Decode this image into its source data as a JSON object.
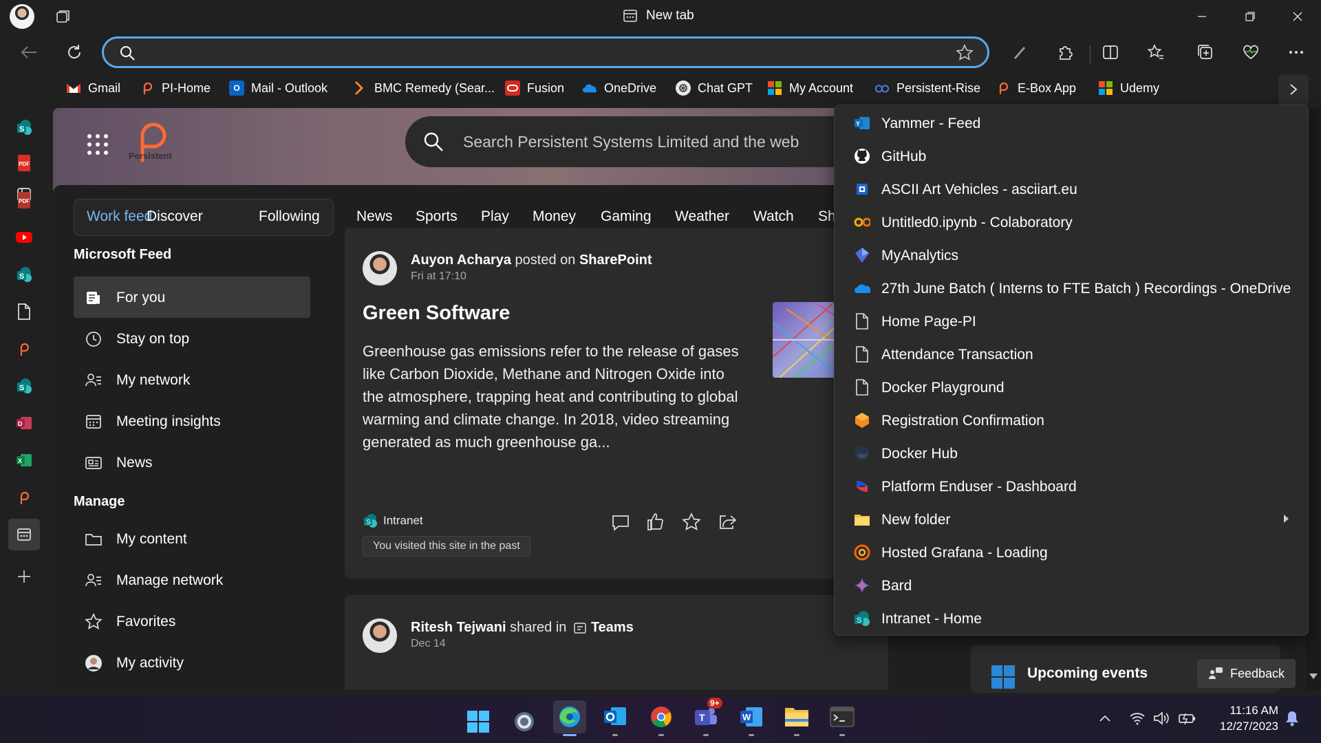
{
  "window": {
    "title": "New tab"
  },
  "toolbar": {
    "address_value": "",
    "address_placeholder": ""
  },
  "favorites": [
    {
      "label": "Gmail",
      "icon": "gmail-icon"
    },
    {
      "label": "PI-Home",
      "icon": "persistent-icon"
    },
    {
      "label": "Mail - Outlook",
      "icon": "outlook-icon"
    },
    {
      "label": "BMC Remedy (Sear...",
      "icon": "bmc-icon"
    },
    {
      "label": "Fusion",
      "icon": "oracle-icon"
    },
    {
      "label": "OneDrive",
      "icon": "onedrive-icon"
    },
    {
      "label": "Chat GPT",
      "icon": "chatgpt-icon"
    },
    {
      "label": "My Account",
      "icon": "microsoft-icon"
    },
    {
      "label": "Persistent-Rise",
      "icon": "rise-icon"
    },
    {
      "label": "E-Box App",
      "icon": "persistent-icon"
    },
    {
      "label": "Udemy",
      "icon": "microsoft-icon"
    }
  ],
  "hero": {
    "search_placeholder": "Search Persistent Systems Limited and the web",
    "logo_text": "Persistent"
  },
  "tabs": {
    "pill": [
      "Work feed",
      "Discover",
      "Following"
    ],
    "categories": [
      "News",
      "Sports",
      "Play",
      "Money",
      "Gaming",
      "Weather",
      "Watch",
      "Sh"
    ]
  },
  "feed_nav": {
    "heading": "Microsoft Feed",
    "items": [
      {
        "label": "For you",
        "icon": "news-feed-icon"
      },
      {
        "label": "Stay on top",
        "icon": "clock-icon"
      },
      {
        "label": "My network",
        "icon": "people-icon"
      },
      {
        "label": "Meeting insights",
        "icon": "calendar-icon"
      },
      {
        "label": "News",
        "icon": "newspaper-icon"
      }
    ],
    "manage_heading": "Manage",
    "manage_items": [
      {
        "label": "My content",
        "icon": "folder-icon"
      },
      {
        "label": "Manage network",
        "icon": "people-icon"
      },
      {
        "label": "Favorites",
        "icon": "star-icon"
      },
      {
        "label": "My activity",
        "icon": "avatar-icon"
      }
    ]
  },
  "post1": {
    "author": "Auyon Acharya",
    "verb": " posted on ",
    "site": "SharePoint",
    "date": "Fri at 17:10",
    "title": "Green Software",
    "body": "Greenhouse gas emissions refer to the release of gases like Carbon Dioxide, Methane and Nitrogen Oxide into the atmosphere, trapping heat and contributing to global warming and climate change. In 2018, video streaming generated as much greenhouse ga...",
    "source": "Intranet",
    "visited": "You visited this site in the past"
  },
  "post2": {
    "author": "Ritesh Tejwani",
    "verb": " shared in ",
    "site": "Teams",
    "date": "Dec 14"
  },
  "upcoming": {
    "label": "Upcoming events"
  },
  "feedback": {
    "label": "Feedback"
  },
  "menu": {
    "items": [
      {
        "label": "Yammer - Feed",
        "icon": "yammer-icon"
      },
      {
        "label": "GitHub",
        "icon": "github-icon"
      },
      {
        "label": "ASCII Art Vehicles - asciiart.eu",
        "icon": "asciiart-icon"
      },
      {
        "label": "Untitled0.ipynb - Colaboratory",
        "icon": "colab-icon"
      },
      {
        "label": "MyAnalytics",
        "icon": "myanalytics-icon"
      },
      {
        "label": "27th June Batch ( Interns to FTE Batch ) Recordings - OneDrive",
        "icon": "onedrive-icon"
      },
      {
        "label": "Home Page-PI",
        "icon": "page-icon"
      },
      {
        "label": "Attendance Transaction",
        "icon": "page-icon"
      },
      {
        "label": "Docker Playground",
        "icon": "page-icon"
      },
      {
        "label": "Registration Confirmation",
        "icon": "cube-icon"
      },
      {
        "label": "Docker Hub",
        "icon": "docker-icon"
      },
      {
        "label": "Platform Enduser - Dashboard",
        "icon": "platform-icon"
      },
      {
        "label": "New folder",
        "icon": "folder-icon"
      },
      {
        "label": "Hosted Grafana - Loading",
        "icon": "grafana-icon"
      },
      {
        "label": "Bard",
        "icon": "bard-icon"
      },
      {
        "label": "Intranet - Home",
        "icon": "sharepoint-icon"
      }
    ]
  },
  "taskbar": {
    "teams_badge": "9+",
    "time": "11:16 AM",
    "date": "12/27/2023"
  },
  "colors": {
    "accent": "#5aa7ee",
    "active_tab": "#79b8f2",
    "menu_bg": "#2b2b2b"
  }
}
